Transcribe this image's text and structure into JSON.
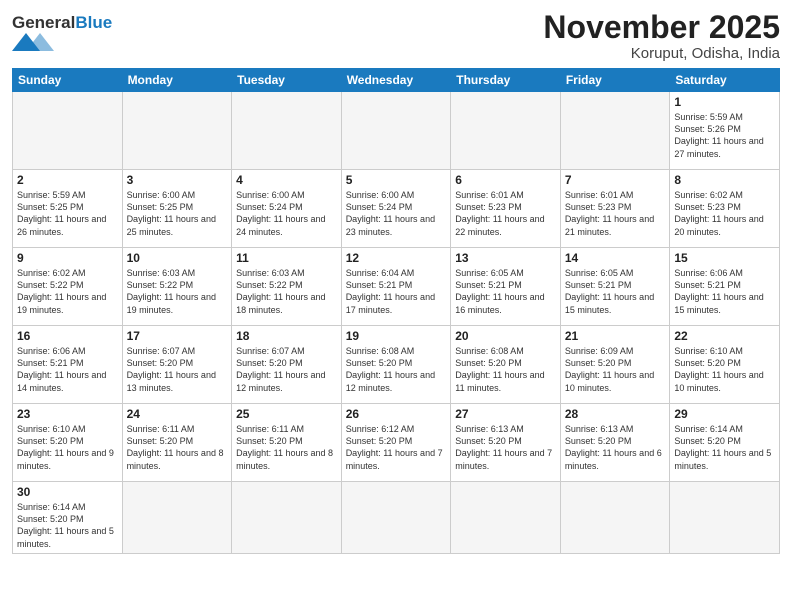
{
  "header": {
    "logo_general": "General",
    "logo_blue": "Blue",
    "month": "November 2025",
    "location": "Koruput, Odisha, India"
  },
  "weekdays": [
    "Sunday",
    "Monday",
    "Tuesday",
    "Wednesday",
    "Thursday",
    "Friday",
    "Saturday"
  ],
  "weeks": [
    [
      {
        "day": "",
        "info": ""
      },
      {
        "day": "",
        "info": ""
      },
      {
        "day": "",
        "info": ""
      },
      {
        "day": "",
        "info": ""
      },
      {
        "day": "",
        "info": ""
      },
      {
        "day": "",
        "info": ""
      },
      {
        "day": "1",
        "info": "Sunrise: 5:59 AM\nSunset: 5:26 PM\nDaylight: 11 hours\nand 27 minutes."
      }
    ],
    [
      {
        "day": "2",
        "info": "Sunrise: 5:59 AM\nSunset: 5:25 PM\nDaylight: 11 hours\nand 26 minutes."
      },
      {
        "day": "3",
        "info": "Sunrise: 6:00 AM\nSunset: 5:25 PM\nDaylight: 11 hours\nand 25 minutes."
      },
      {
        "day": "4",
        "info": "Sunrise: 6:00 AM\nSunset: 5:24 PM\nDaylight: 11 hours\nand 24 minutes."
      },
      {
        "day": "5",
        "info": "Sunrise: 6:00 AM\nSunset: 5:24 PM\nDaylight: 11 hours\nand 23 minutes."
      },
      {
        "day": "6",
        "info": "Sunrise: 6:01 AM\nSunset: 5:23 PM\nDaylight: 11 hours\nand 22 minutes."
      },
      {
        "day": "7",
        "info": "Sunrise: 6:01 AM\nSunset: 5:23 PM\nDaylight: 11 hours\nand 21 minutes."
      },
      {
        "day": "8",
        "info": "Sunrise: 6:02 AM\nSunset: 5:23 PM\nDaylight: 11 hours\nand 20 minutes."
      }
    ],
    [
      {
        "day": "9",
        "info": "Sunrise: 6:02 AM\nSunset: 5:22 PM\nDaylight: 11 hours\nand 19 minutes."
      },
      {
        "day": "10",
        "info": "Sunrise: 6:03 AM\nSunset: 5:22 PM\nDaylight: 11 hours\nand 19 minutes."
      },
      {
        "day": "11",
        "info": "Sunrise: 6:03 AM\nSunset: 5:22 PM\nDaylight: 11 hours\nand 18 minutes."
      },
      {
        "day": "12",
        "info": "Sunrise: 6:04 AM\nSunset: 5:21 PM\nDaylight: 11 hours\nand 17 minutes."
      },
      {
        "day": "13",
        "info": "Sunrise: 6:05 AM\nSunset: 5:21 PM\nDaylight: 11 hours\nand 16 minutes."
      },
      {
        "day": "14",
        "info": "Sunrise: 6:05 AM\nSunset: 5:21 PM\nDaylight: 11 hours\nand 15 minutes."
      },
      {
        "day": "15",
        "info": "Sunrise: 6:06 AM\nSunset: 5:21 PM\nDaylight: 11 hours\nand 15 minutes."
      }
    ],
    [
      {
        "day": "16",
        "info": "Sunrise: 6:06 AM\nSunset: 5:21 PM\nDaylight: 11 hours\nand 14 minutes."
      },
      {
        "day": "17",
        "info": "Sunrise: 6:07 AM\nSunset: 5:20 PM\nDaylight: 11 hours\nand 13 minutes."
      },
      {
        "day": "18",
        "info": "Sunrise: 6:07 AM\nSunset: 5:20 PM\nDaylight: 11 hours\nand 12 minutes."
      },
      {
        "day": "19",
        "info": "Sunrise: 6:08 AM\nSunset: 5:20 PM\nDaylight: 11 hours\nand 12 minutes."
      },
      {
        "day": "20",
        "info": "Sunrise: 6:08 AM\nSunset: 5:20 PM\nDaylight: 11 hours\nand 11 minutes."
      },
      {
        "day": "21",
        "info": "Sunrise: 6:09 AM\nSunset: 5:20 PM\nDaylight: 11 hours\nand 10 minutes."
      },
      {
        "day": "22",
        "info": "Sunrise: 6:10 AM\nSunset: 5:20 PM\nDaylight: 11 hours\nand 10 minutes."
      }
    ],
    [
      {
        "day": "23",
        "info": "Sunrise: 6:10 AM\nSunset: 5:20 PM\nDaylight: 11 hours\nand 9 minutes."
      },
      {
        "day": "24",
        "info": "Sunrise: 6:11 AM\nSunset: 5:20 PM\nDaylight: 11 hours\nand 8 minutes."
      },
      {
        "day": "25",
        "info": "Sunrise: 6:11 AM\nSunset: 5:20 PM\nDaylight: 11 hours\nand 8 minutes."
      },
      {
        "day": "26",
        "info": "Sunrise: 6:12 AM\nSunset: 5:20 PM\nDaylight: 11 hours\nand 7 minutes."
      },
      {
        "day": "27",
        "info": "Sunrise: 6:13 AM\nSunset: 5:20 PM\nDaylight: 11 hours\nand 7 minutes."
      },
      {
        "day": "28",
        "info": "Sunrise: 6:13 AM\nSunset: 5:20 PM\nDaylight: 11 hours\nand 6 minutes."
      },
      {
        "day": "29",
        "info": "Sunrise: 6:14 AM\nSunset: 5:20 PM\nDaylight: 11 hours\nand 5 minutes."
      }
    ],
    [
      {
        "day": "30",
        "info": "Sunrise: 6:14 AM\nSunset: 5:20 PM\nDaylight: 11 hours\nand 5 minutes."
      },
      {
        "day": "",
        "info": ""
      },
      {
        "day": "",
        "info": ""
      },
      {
        "day": "",
        "info": ""
      },
      {
        "day": "",
        "info": ""
      },
      {
        "day": "",
        "info": ""
      },
      {
        "day": "",
        "info": ""
      }
    ]
  ]
}
